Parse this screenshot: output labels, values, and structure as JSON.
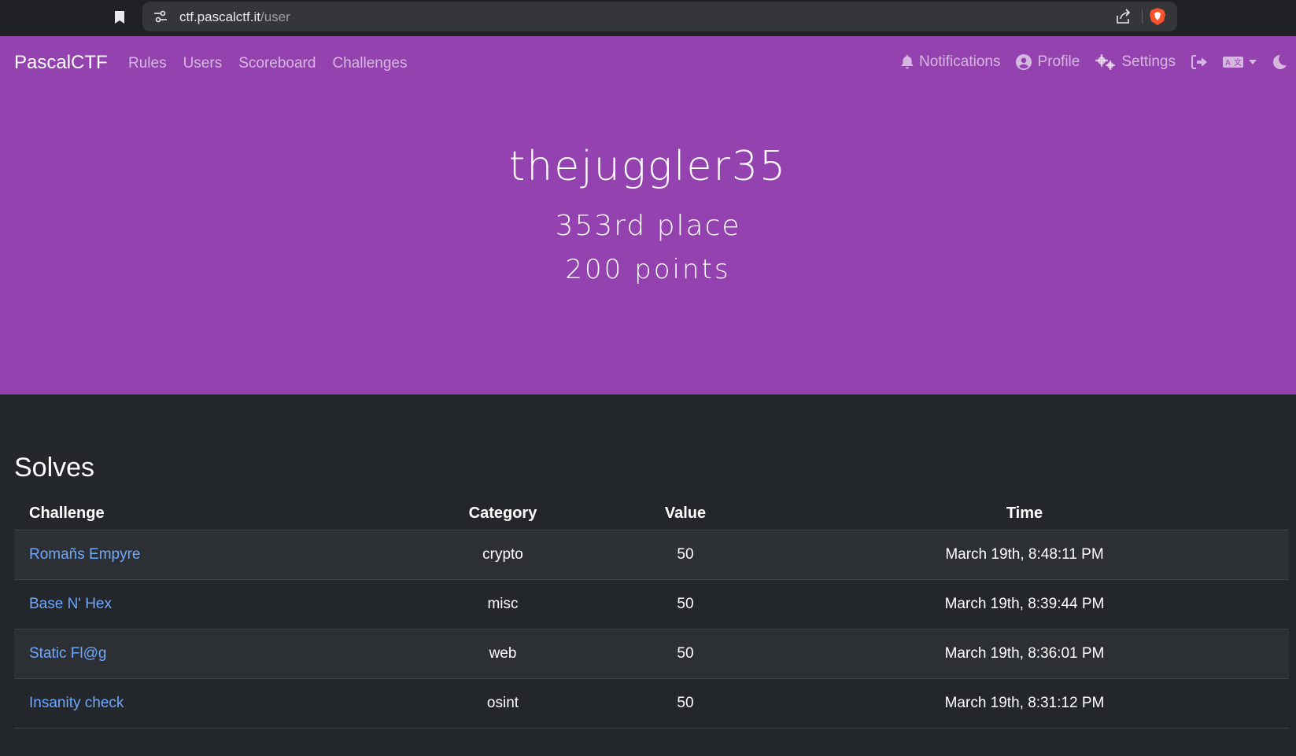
{
  "browser": {
    "url_host": "ctf.pascalctf.it",
    "url_path": "/user",
    "icons": [
      "bookmark-icon",
      "site-info-icon",
      "share-icon",
      "brave-shield-icon"
    ]
  },
  "navbar": {
    "brand": "PascalCTF",
    "links": [
      "Rules",
      "Users",
      "Scoreboard",
      "Challenges"
    ],
    "notifications": "Notifications",
    "profile": "Profile",
    "settings": "Settings"
  },
  "hero": {
    "username": "thejuggler35",
    "place": "353rd place",
    "points": "200 points",
    "background": "#9342af"
  },
  "solves": {
    "title": "Solves",
    "headers": [
      "Challenge",
      "Category",
      "Value",
      "Time"
    ],
    "rows": [
      {
        "challenge": "Romañs Empyre",
        "category": "crypto",
        "value": "50",
        "time": "March 19th, 8:48:11 PM"
      },
      {
        "challenge": "Base N' Hex",
        "category": "misc",
        "value": "50",
        "time": "March 19th, 8:39:44 PM"
      },
      {
        "challenge": "Static Fl@g",
        "category": "web",
        "value": "50",
        "time": "March 19th, 8:36:01 PM"
      },
      {
        "challenge": "Insanity check",
        "category": "osint",
        "value": "50",
        "time": "March 19th, 8:31:12 PM"
      }
    ],
    "link_color": "#6ea8fe"
  }
}
